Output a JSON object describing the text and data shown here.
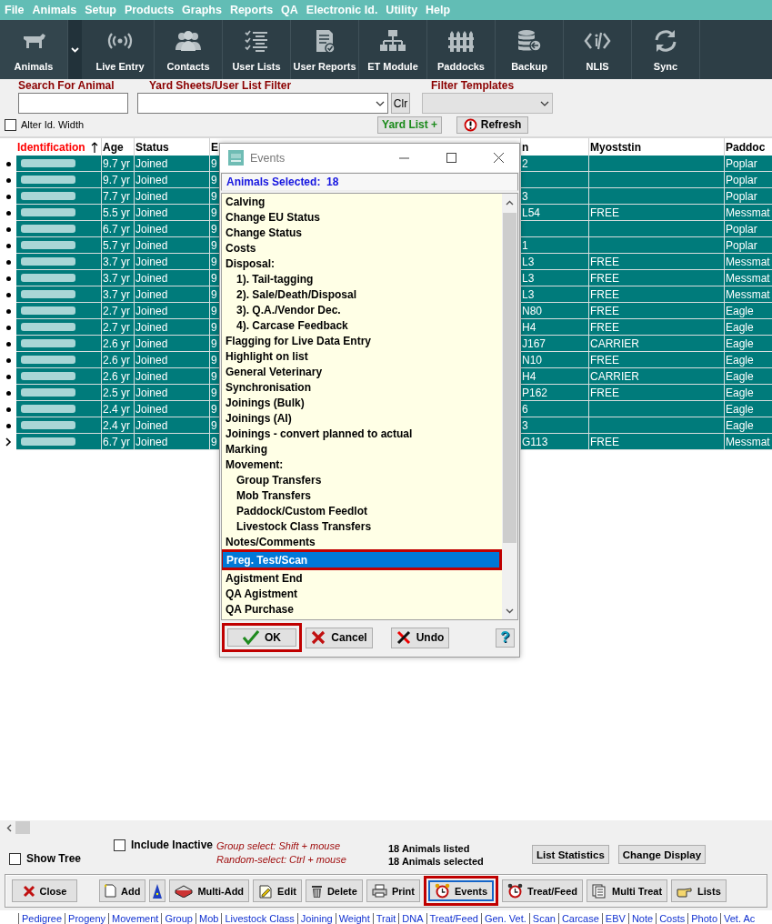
{
  "menu": [
    "File",
    "Animals",
    "Setup",
    "Products",
    "Graphs",
    "Reports",
    "QA",
    "Electronic Id.",
    "Utility",
    "Help"
  ],
  "toolbar": [
    {
      "label": "Animals",
      "dropdown": true
    },
    {
      "label": "Live Entry",
      "dropdown": false
    },
    {
      "label": "Contacts",
      "dropdown": false
    },
    {
      "label": "User Lists",
      "dropdown": false
    },
    {
      "label": "User Reports",
      "dropdown": false
    },
    {
      "label": "ET Module",
      "dropdown": false
    },
    {
      "label": "Paddocks",
      "dropdown": false
    },
    {
      "label": "Backup",
      "dropdown": false
    },
    {
      "label": "NLIS",
      "dropdown": false
    },
    {
      "label": "Sync",
      "dropdown": false
    }
  ],
  "filters": {
    "search_label": "Search For Animal",
    "yard_label": "Yard Sheets/User List Filter",
    "clear_button": "Clr",
    "templates_label": "Filter Templates",
    "templates_disabled": true,
    "alter_width": {
      "label": "Alter Id. Width",
      "checked": false
    },
    "yard_list_button": "Yard List +",
    "refresh_button": "Refresh"
  },
  "table": {
    "columns": [
      {
        "label": "Identification",
        "sorted": true
      },
      {
        "label": "Age",
        "sorted": false
      },
      {
        "label": "Status",
        "sorted": false
      },
      {
        "label": "E",
        "sorted": false
      },
      {
        "label": "n",
        "sorted": false
      },
      {
        "label": "Myoststin",
        "sorted": false
      },
      {
        "label": "Paddoc",
        "sorted": false
      }
    ],
    "rows": [
      {
        "selected": true,
        "current": false,
        "age": "9.7 yr",
        "status": "Joined",
        "column_4": "9",
        "column_5": "2",
        "paddock": "Poplar"
      },
      {
        "selected": true,
        "current": false,
        "age": "9.7 yr",
        "status": "Joined",
        "column_4": "9",
        "paddock": "Poplar"
      },
      {
        "selected": true,
        "current": false,
        "age": "7.7 yr",
        "status": "Joined",
        "column_4": "9",
        "column_5": "3",
        "paddock": "Poplar"
      },
      {
        "selected": true,
        "current": false,
        "age": "5.5 yr",
        "status": "Joined",
        "column_4": "9",
        "column_5": "L54",
        "myoststin": "FREE",
        "paddock": "Messmat"
      },
      {
        "selected": true,
        "current": false,
        "age": "6.7 yr",
        "status": "Joined",
        "column_4": "9",
        "paddock": "Poplar"
      },
      {
        "selected": true,
        "current": false,
        "age": "5.7 yr",
        "status": "Joined",
        "column_4": "9",
        "column_5": "1",
        "paddock": "Poplar"
      },
      {
        "selected": true,
        "current": false,
        "age": "3.7 yr",
        "status": "Joined",
        "column_4": "9",
        "column_5": "L3",
        "myoststin": "FREE",
        "paddock": "Messmat"
      },
      {
        "selected": true,
        "current": false,
        "age": "3.7 yr",
        "status": "Joined",
        "column_4": "9",
        "column_5": "L3",
        "myoststin": "FREE",
        "paddock": "Messmat"
      },
      {
        "selected": true,
        "current": false,
        "age": "3.7 yr",
        "status": "Joined",
        "column_4": "9",
        "column_5": "L3",
        "myoststin": "FREE",
        "paddock": "Messmat"
      },
      {
        "selected": true,
        "current": false,
        "age": "2.7 yr",
        "status": "Joined",
        "column_4": "9",
        "column_5": "N80",
        "myoststin": "FREE",
        "paddock": "Eagle"
      },
      {
        "selected": true,
        "current": false,
        "age": "2.7 yr",
        "status": "Joined",
        "column_4": "9",
        "column_5": "H4",
        "myoststin": "FREE",
        "paddock": "Eagle"
      },
      {
        "selected": true,
        "current": false,
        "age": "2.6 yr",
        "status": "Joined",
        "column_4": "9",
        "column_5": "J167",
        "myoststin": "CARRIER",
        "paddock": "Eagle"
      },
      {
        "selected": true,
        "current": false,
        "age": "2.6 yr",
        "status": "Joined",
        "column_4": "9",
        "column_5": "N10",
        "myoststin": "FREE",
        "paddock": "Eagle"
      },
      {
        "selected": true,
        "current": false,
        "age": "2.6 yr",
        "status": "Joined",
        "column_4": "9",
        "column_5": "H4",
        "myoststin": "CARRIER",
        "paddock": "Eagle"
      },
      {
        "selected": true,
        "current": false,
        "age": "2.5 yr",
        "status": "Joined",
        "column_4": "9",
        "column_5": "P162",
        "myoststin": "FREE",
        "paddock": "Eagle"
      },
      {
        "selected": true,
        "current": false,
        "age": "2.4 yr",
        "status": "Joined",
        "column_4": "9",
        "column_5": "6",
        "paddock": "Eagle"
      },
      {
        "selected": true,
        "current": false,
        "age": "2.4 yr",
        "status": "Joined",
        "column_4": "9",
        "column_5": "3",
        "paddock": "Eagle"
      },
      {
        "selected": true,
        "current": true,
        "age": "6.7 yr",
        "status": "Joined",
        "column_4": "9",
        "column_5": "G113",
        "myoststin": "FREE",
        "paddock": "Messmat"
      }
    ]
  },
  "dialog": {
    "title": "Events",
    "info": "Animals Selected:  18",
    "items": [
      {
        "label": "Calving",
        "selected": false,
        "highlighted": false
      },
      {
        "label": "Change EU Status",
        "selected": false,
        "highlighted": false
      },
      {
        "label": "Change Status",
        "selected": false,
        "highlighted": false
      },
      {
        "label": "Costs",
        "selected": false,
        "highlighted": false
      },
      {
        "label": "Disposal:",
        "selected": false,
        "highlighted": false,
        "children": [
          {
            "label": "1). Tail-tagging",
            "selected": false,
            "highlighted": false
          },
          {
            "label": "2). Sale/Death/Disposal",
            "selected": false,
            "highlighted": false
          },
          {
            "label": "3). Q.A./Vendor Dec.",
            "selected": false,
            "highlighted": false
          },
          {
            "label": "4). Carcase Feedback",
            "selected": false,
            "highlighted": false
          }
        ]
      },
      {
        "label": "Flagging for Live Data Entry",
        "selected": false,
        "highlighted": false
      },
      {
        "label": "Highlight on list",
        "selected": false,
        "highlighted": false
      },
      {
        "label": "General Veterinary",
        "selected": false,
        "highlighted": false
      },
      {
        "label": "Synchronisation",
        "selected": false,
        "highlighted": false
      },
      {
        "label": "Joinings (Bulk)",
        "selected": false,
        "highlighted": false
      },
      {
        "label": "Joinings (AI)",
        "selected": false,
        "highlighted": false
      },
      {
        "label": "Joinings - convert planned to actual",
        "selected": false,
        "highlighted": false
      },
      {
        "label": "Marking",
        "selected": false,
        "highlighted": false
      },
      {
        "label": "Movement:",
        "selected": false,
        "highlighted": false,
        "children": [
          {
            "label": "Group Transfers",
            "selected": false,
            "highlighted": false
          },
          {
            "label": "Mob Transfers",
            "selected": false,
            "highlighted": false
          },
          {
            "label": "Paddock/Custom Feedlot",
            "selected": false,
            "highlighted": false
          },
          {
            "label": "Livestock Class Transfers",
            "selected": false,
            "highlighted": false
          }
        ]
      },
      {
        "label": "Notes/Comments",
        "selected": false,
        "highlighted": false
      },
      {
        "label": "Preg. Test/Scan",
        "selected": true,
        "highlighted": true
      },
      {
        "label": "Agistment End",
        "selected": false,
        "highlighted": false
      },
      {
        "label": "QA Agistment",
        "selected": false,
        "highlighted": false
      },
      {
        "label": "QA Purchase",
        "selected": false,
        "highlighted": false
      }
    ],
    "buttons": [
      {
        "kind": "ok",
        "label": "OK",
        "highlighted": true
      },
      {
        "kind": "cancel",
        "label": "Cancel",
        "highlighted": false
      },
      {
        "kind": "undo",
        "label": "Undo",
        "highlighted": false
      },
      {
        "kind": "help",
        "label": "?",
        "highlighted": false
      }
    ]
  },
  "options": {
    "include_inactive": {
      "label": "Include Inactive",
      "checked": false
    },
    "show_tree": {
      "label": "Show Tree",
      "checked": false
    },
    "hints": [
      "Group select: Shift + mouse",
      "Random-select: Ctrl + mouse"
    ],
    "counts": [
      "18 Animals listed",
      "18 Animals selected"
    ],
    "buttons": [
      "List Statistics",
      "Change Display"
    ]
  },
  "actions": [
    {
      "kind": "close",
      "label": "Close",
      "highlighted": false
    },
    {
      "kind": "add",
      "label": "Add",
      "highlighted": false
    },
    {
      "kind": "wizard",
      "highlighted": false
    },
    {
      "kind": "multi_add",
      "label": "Multi-Add",
      "highlighted": false
    },
    {
      "kind": "edit",
      "label": "Edit",
      "highlighted": false
    },
    {
      "kind": "delete",
      "label": "Delete",
      "highlighted": false
    },
    {
      "kind": "print",
      "label": "Print",
      "highlighted": false
    },
    {
      "kind": "events",
      "label": "Events",
      "highlighted": true
    },
    {
      "kind": "treat",
      "label": "Treat/Feed",
      "highlighted": false
    },
    {
      "kind": "multi_treat",
      "label": "Multi Treat",
      "highlighted": false
    },
    {
      "kind": "lists",
      "label": "Lists",
      "highlighted": false
    }
  ],
  "links": [
    "Pedigree",
    "Progeny",
    "Movement",
    "Group",
    "Mob",
    "Livestock Class",
    "Joining",
    "Weight",
    "Trait",
    "DNA",
    "Treat/Feed",
    "Gen. Vet.",
    "Scan",
    "Carcase",
    "EBV",
    "Note",
    "Costs",
    "Photo",
    "Vet. Ac"
  ]
}
